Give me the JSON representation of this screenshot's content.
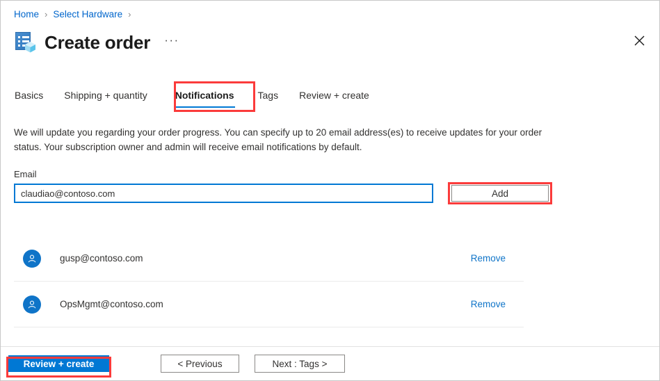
{
  "breadcrumb": {
    "items": [
      {
        "label": "Home"
      },
      {
        "label": "Select Hardware"
      }
    ],
    "separator": "›"
  },
  "header": {
    "title": "Create order",
    "more_options": "···",
    "close_label": "✕",
    "icon": "create-order-icon"
  },
  "tabs": [
    {
      "label": "Basics",
      "active": false
    },
    {
      "label": "Shipping + quantity",
      "active": false
    },
    {
      "label": "Notifications",
      "active": true,
      "annotated": true
    },
    {
      "label": "Tags",
      "active": false
    },
    {
      "label": "Review + create",
      "active": false
    }
  ],
  "main": {
    "description": "We will update you regarding your order progress. You can specify up to 20 email address(es) to receive updates for your order status. Your subscription owner and admin will receive email notifications by default.",
    "email_label": "Email",
    "email_value": "claudiao@contoso.com",
    "email_placeholder": "",
    "add_button": "Add",
    "recipients": [
      {
        "email": "gusp@contoso.com",
        "remove_label": "Remove"
      },
      {
        "email": "OpsMgmt@contoso.com",
        "remove_label": "Remove"
      }
    ]
  },
  "footer": {
    "review_create": "Review + create",
    "previous": "< Previous",
    "next": "Next : Tags >"
  },
  "colors": {
    "accent": "#0078d4",
    "link": "#0f74c8",
    "annotation": "#fb3b3b",
    "text": "#323130"
  }
}
